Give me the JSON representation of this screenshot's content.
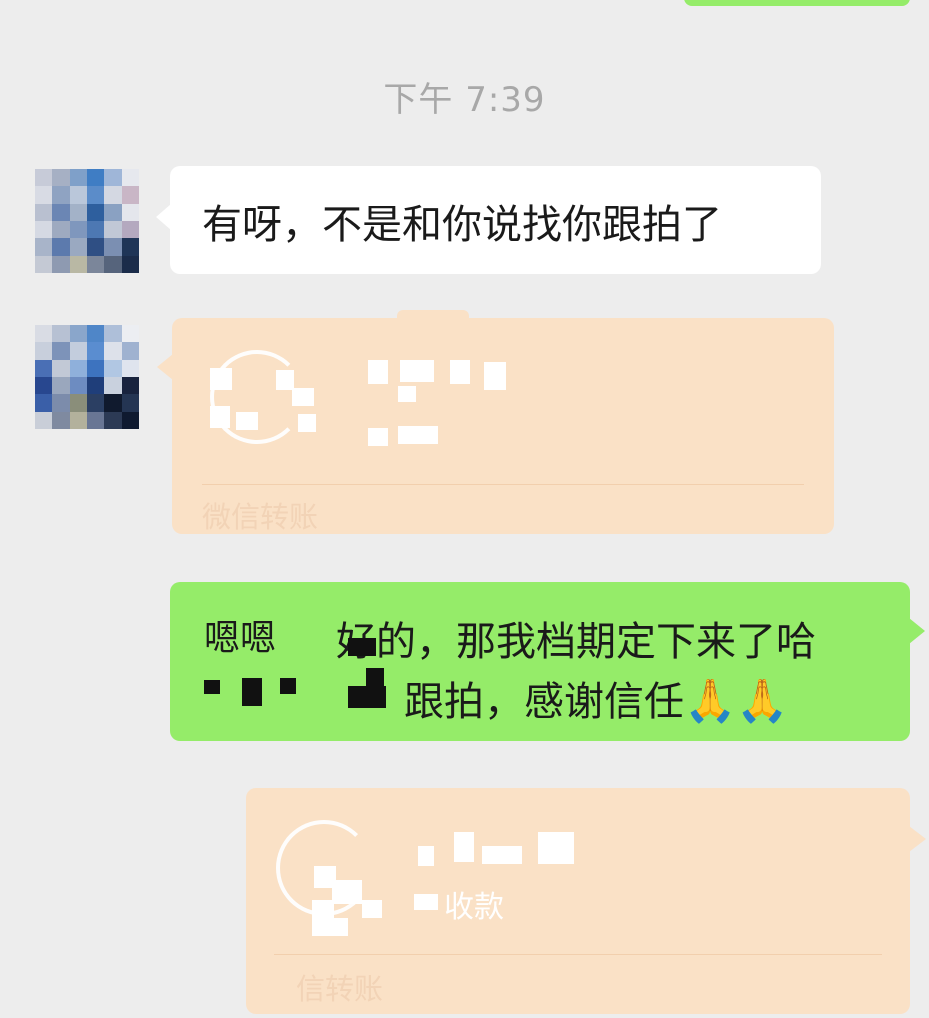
{
  "chat": {
    "timestamp": "下午 7:39",
    "messages": [
      {
        "sender": "contact",
        "type": "text",
        "text": "有呀，不是和你说找你跟拍了"
      },
      {
        "sender": "contact",
        "type": "transfer",
        "footer": "微信转账"
      },
      {
        "sender": "me",
        "type": "text",
        "line1_a": "嗯嗯",
        "line1_b": "好的，那我档期定下来了哈",
        "line2": "跟拍，感谢信任",
        "emoji": "🙏🙏"
      },
      {
        "sender": "me",
        "type": "transfer",
        "status": "收款",
        "footer": "信转账"
      }
    ]
  },
  "colors": {
    "background": "#ededed",
    "bubble_self": "#95ec69",
    "bubble_other": "#ffffff",
    "transfer_card": "#fae1c6",
    "timestamp_text": "#a8a8a8"
  },
  "icons": {
    "avatar_contact": "pixelated-avatar",
    "transfer": "transfer-ring-icon"
  }
}
